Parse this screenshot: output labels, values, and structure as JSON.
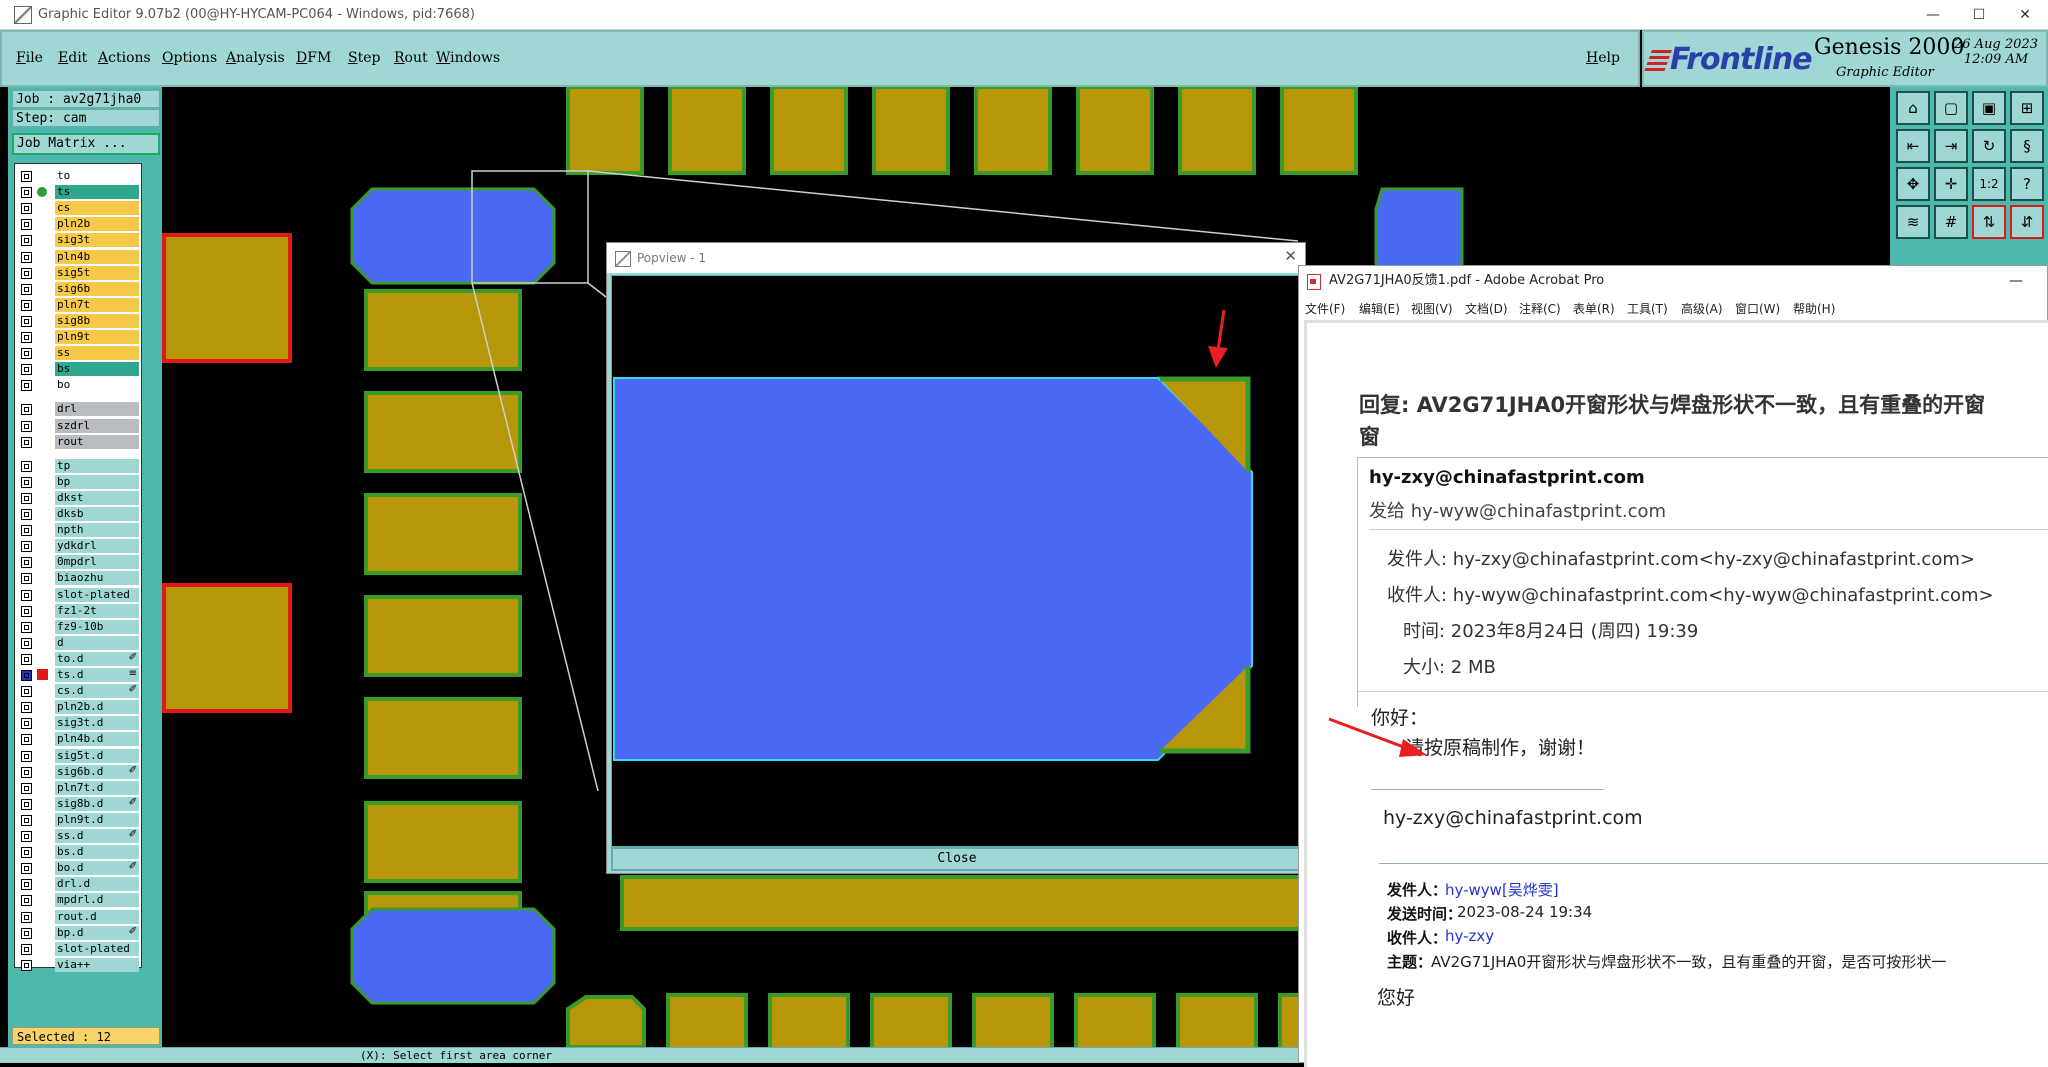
{
  "window": {
    "title": "Graphic Editor 9.07b2 (00@HY-HYCAM-PC064 - Windows, pid:7668)",
    "minimize": "—",
    "maximize": "☐",
    "close": "✕"
  },
  "menubar": {
    "items": [
      "File",
      "Edit",
      "Actions",
      "Options",
      "Analysis",
      "DFM",
      "Step",
      "Rout",
      "Windows"
    ],
    "help": "Help"
  },
  "brand": {
    "logo": "Frontline",
    "product": "Genesis 2000",
    "subtitle": "Graphic Editor",
    "date": "26 Aug 2023",
    "time": "12:09 AM"
  },
  "job": {
    "job_line": "Job : av2g71jha0",
    "step_line": "Step: cam",
    "matrix_button": "Job Matrix ..."
  },
  "layers": [
    {
      "name": "to",
      "color": "#ffffff"
    },
    {
      "name": "ts",
      "color": "#2fa88f",
      "active": true
    },
    {
      "name": "cs",
      "color": "#f7c948"
    },
    {
      "name": "pln2b",
      "color": "#f7c948"
    },
    {
      "name": "sig3t",
      "color": "#f7c948"
    },
    {
      "name": "pln4b",
      "color": "#f7c948"
    },
    {
      "name": "sig5t",
      "color": "#f7c948"
    },
    {
      "name": "sig6b",
      "color": "#f7c948"
    },
    {
      "name": "pln7t",
      "color": "#f7c948"
    },
    {
      "name": "sig8b",
      "color": "#f7c948"
    },
    {
      "name": "pln9t",
      "color": "#f7c948"
    },
    {
      "name": "ss",
      "color": "#f7c948"
    },
    {
      "name": "bs",
      "color": "#2fa88f"
    },
    {
      "name": "bo",
      "color": "#ffffff"
    },
    {
      "name": "drl",
      "color": "#b8bcc0"
    },
    {
      "name": "szdrl",
      "color": "#b8bcc0"
    },
    {
      "name": "rout",
      "color": "#b8bcc0"
    },
    {
      "name": "tp",
      "color": "#9ed7d4"
    },
    {
      "name": "bp",
      "color": "#9ed7d4"
    },
    {
      "name": "dkst",
      "color": "#9ed7d4"
    },
    {
      "name": "dksb",
      "color": "#9ed7d4"
    },
    {
      "name": "npth",
      "color": "#9ed7d4"
    },
    {
      "name": "ydkdrl",
      "color": "#9ed7d4"
    },
    {
      "name": "0mpdrl",
      "color": "#9ed7d4"
    },
    {
      "name": "biaozhu",
      "color": "#9ed7d4"
    },
    {
      "name": "slot-plated",
      "color": "#9ed7d4"
    },
    {
      "name": "fz1-2t",
      "color": "#9ed7d4"
    },
    {
      "name": "fz9-10b",
      "color": "#9ed7d4"
    },
    {
      "name": "d",
      "color": "#9ed7d4"
    },
    {
      "name": "to.d",
      "color": "#9ed7d4",
      "flag": "✐"
    },
    {
      "name": "ts.d",
      "color": "#9ed7d4",
      "flag": "≡",
      "marked": true
    },
    {
      "name": "cs.d",
      "color": "#9ed7d4",
      "flag": "✐"
    },
    {
      "name": "pln2b.d",
      "color": "#9ed7d4"
    },
    {
      "name": "sig3t.d",
      "color": "#9ed7d4"
    },
    {
      "name": "pln4b.d",
      "color": "#9ed7d4"
    },
    {
      "name": "sig5t.d",
      "color": "#9ed7d4"
    },
    {
      "name": "sig6b.d",
      "color": "#9ed7d4",
      "flag": "✐"
    },
    {
      "name": "pln7t.d",
      "color": "#9ed7d4"
    },
    {
      "name": "sig8b.d",
      "color": "#9ed7d4",
      "flag": "✐"
    },
    {
      "name": "pln9t.d",
      "color": "#9ed7d4"
    },
    {
      "name": "ss.d",
      "color": "#9ed7d4",
      "flag": "✐"
    },
    {
      "name": "bs.d",
      "color": "#9ed7d4"
    },
    {
      "name": "bo.d",
      "color": "#9ed7d4",
      "flag": "✐"
    },
    {
      "name": "drl.d",
      "color": "#9ed7d4"
    },
    {
      "name": "mpdrl.d",
      "color": "#9ed7d4"
    },
    {
      "name": "rout.d",
      "color": "#9ed7d4"
    },
    {
      "name": "bp.d",
      "color": "#9ed7d4",
      "flag": "✐"
    },
    {
      "name": "slot-plated",
      "color": "#9ed7d4"
    },
    {
      "name": "via++",
      "color": "#9ed7d4"
    }
  ],
  "selected": "Selected : 12",
  "status": {
    "prompt": "(X): Select first area corner"
  },
  "colors": {
    "pad": "#b8960a",
    "pad_edge": "#3a9a2a",
    "pad_blue": "#4a69f5",
    "teal": "#4fb8ad",
    "panel": "#9ed7d4"
  },
  "popview": {
    "title": "Popview - 1",
    "close_button": "Close",
    "close_x": "✕"
  },
  "acrobat": {
    "title": "AV2G71JHA0反馈1.pdf - Adobe Acrobat Pro",
    "menu": [
      "文件(F)",
      "编辑(E)",
      "视图(V)",
      "文档(D)",
      "注释(C)",
      "表单(R)",
      "工具(T)",
      "高级(A)",
      "窗口(W)",
      "帮助(H)"
    ],
    "subject_line1": "回复: AV2G71JHA0开窗形状与焊盘形状不一致，且有重叠的开窗",
    "subject_line2": "窗",
    "from_display": "hy-zxy@chinafastprint.com",
    "to_display": "发给 hy-wyw@chinafastprint.com",
    "sender": "发件人: hy-zxy@chinafastprint.com<hy-zxy@chinafastprint.com>",
    "recipient": "收件人: hy-wyw@chinafastprint.com<hy-wyw@chinafastprint.com>",
    "time": "时间: 2023年8月24日 (周四) 19:39",
    "size": "大小: 2 MB",
    "greeting": "你好：",
    "body": "请按原稿制作，谢谢！",
    "signature": "hy-zxy@chinafastprint.com",
    "quoted": {
      "from_label": "发件人：",
      "from_value": "hy-wyw[吴烨雯]",
      "sent_label": "发送时间：",
      "sent_value": "2023-08-24 19:34",
      "to_label": "收件人：",
      "to_value": "hy-zxy",
      "subject_label": "主题：",
      "subject_value": "AV2G71JHA0开窗形状与焊盘形状不一致，且有重叠的开窗，是否可按形状一",
      "greeting": "您好"
    }
  }
}
